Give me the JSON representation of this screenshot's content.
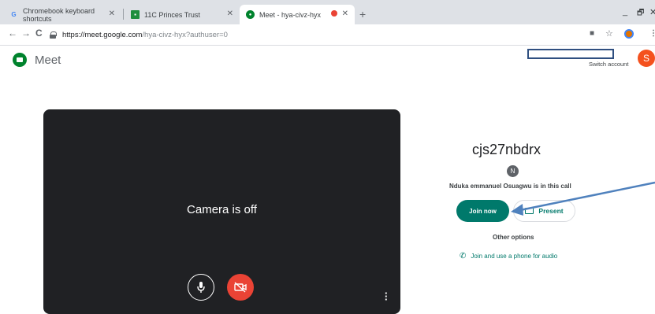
{
  "browser": {
    "tabs": [
      {
        "title": "Chromebook keyboard shortcuts",
        "favicon": "google-g-icon"
      },
      {
        "title": "11C Princes Trust",
        "favicon": "classroom-icon"
      },
      {
        "title": "Meet - hya-civz-hyx",
        "favicon": "meet-icon",
        "recording": true
      }
    ],
    "url_host": "https://meet.google.com",
    "url_path": "/hya-civz-hyx?authuser=0"
  },
  "meet": {
    "app_name": "Meet",
    "switch_account": "Switch account",
    "avatar_initial": "S"
  },
  "preview": {
    "camera_status": "Camera is off"
  },
  "join_panel": {
    "meeting_code": "cjs27nbdrx",
    "participant_initial": "N",
    "in_call_text": "Nduka emmanuel Osuagwu is in this call",
    "join_label": "Join now",
    "present_label": "Present",
    "other_options": "Other options",
    "phone_label": "Join and use a phone for audio"
  },
  "colors": {
    "accent": "#00796b",
    "preview_bg": "#202124",
    "cam_off_red": "#ea4335",
    "arrow": "#4f81bd"
  }
}
